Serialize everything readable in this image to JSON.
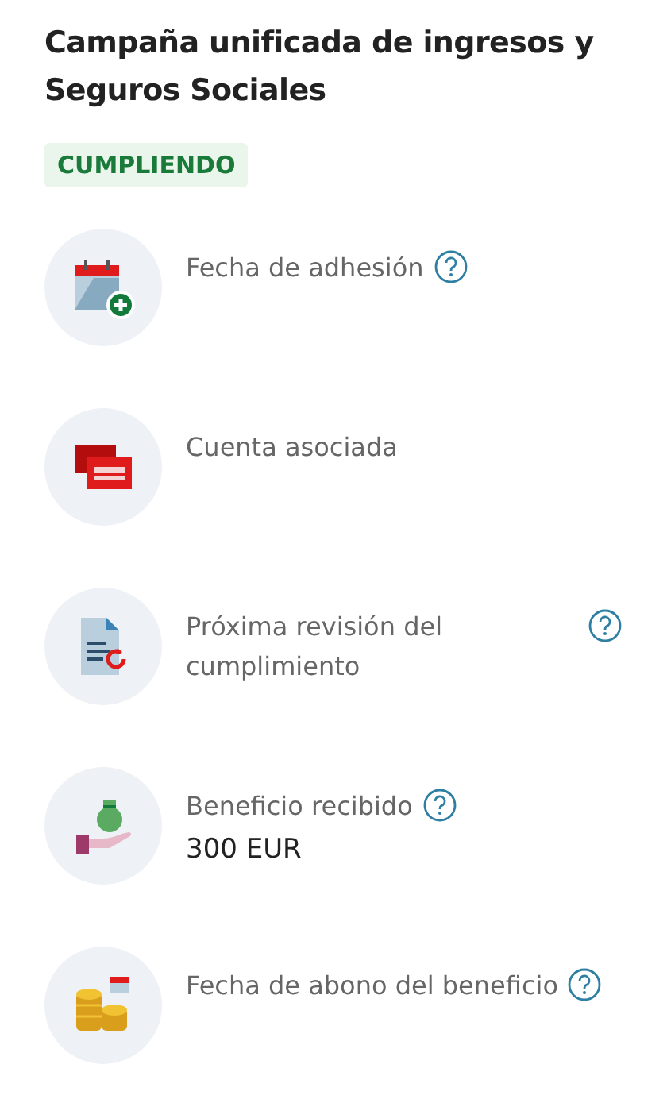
{
  "title": "Campaña unificada de ingresos y Seguros Sociales",
  "status_badge": "CUMPLIENDO",
  "items": [
    {
      "kind": "calendar",
      "label": "Fecha de adhesión",
      "help": true
    },
    {
      "kind": "cards",
      "label": "Cuenta asociada",
      "help": false
    },
    {
      "kind": "document",
      "label": "Próxima revisión del cumplimiento",
      "help": true
    },
    {
      "kind": "money",
      "label": "Beneficio recibido",
      "help": true,
      "value": "300 EUR"
    },
    {
      "kind": "coins",
      "label": "Fecha de abono del beneficio",
      "help": true
    }
  ]
}
